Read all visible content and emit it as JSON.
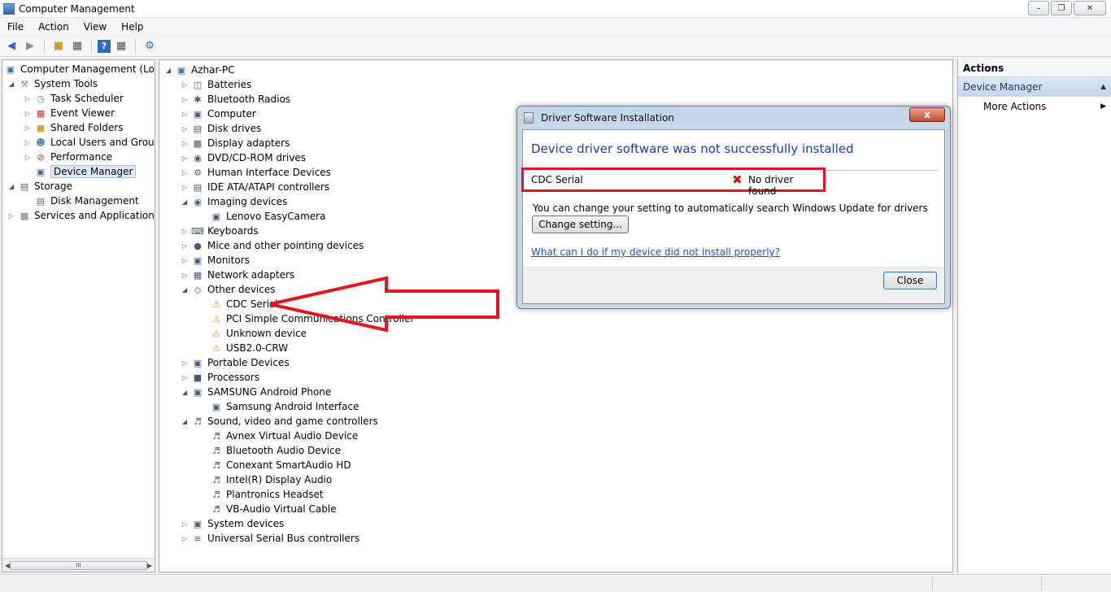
{
  "window": {
    "title": "Computer Management"
  },
  "menu": [
    "File",
    "Action",
    "View",
    "Help"
  ],
  "toolbar": {
    "icons": [
      "back-arrow-icon",
      "forward-arrow-icon",
      "up-folder-icon",
      "show-hide-tree-icon",
      "help-icon",
      "properties-icon",
      "scan-hardware-icon"
    ]
  },
  "tree": {
    "root": "Computer Management (Local",
    "system_tools": "System Tools",
    "task_scheduler": "Task Scheduler",
    "event_viewer": "Event Viewer",
    "shared_folders": "Shared Folders",
    "local_users": "Local Users and Groups",
    "performance": "Performance",
    "device_manager": "Device Manager",
    "storage": "Storage",
    "disk_management": "Disk Management",
    "services": "Services and Applications",
    "scroll_grip": "III"
  },
  "devices": {
    "computer_name": "Azhar-PC",
    "categories": [
      {
        "label": "Batteries",
        "expanded": false
      },
      {
        "label": "Bluetooth Radios",
        "expanded": false
      },
      {
        "label": "Computer",
        "expanded": false
      },
      {
        "label": "Disk drives",
        "expanded": false
      },
      {
        "label": "Display adapters",
        "expanded": false
      },
      {
        "label": "DVD/CD-ROM drives",
        "expanded": false
      },
      {
        "label": "Human Interface Devices",
        "expanded": false
      },
      {
        "label": "IDE ATA/ATAPI controllers",
        "expanded": false
      },
      {
        "label": "Imaging devices",
        "expanded": true
      },
      {
        "label": "Lenovo EasyCamera",
        "child": true
      },
      {
        "label": "Keyboards",
        "expanded": false
      },
      {
        "label": "Mice and other pointing devices",
        "expanded": false
      },
      {
        "label": "Monitors",
        "expanded": false
      },
      {
        "label": "Network adapters",
        "expanded": false
      },
      {
        "label": "Other devices",
        "expanded": true
      },
      {
        "label": "CDC Serial",
        "child": true,
        "warning": true
      },
      {
        "label": "PCI Simple Communications Controller",
        "child": true,
        "warning": true
      },
      {
        "label": "Unknown device",
        "child": true,
        "warning": true
      },
      {
        "label": "USB2.0-CRW",
        "child": true,
        "warning": true
      },
      {
        "label": "Portable Devices",
        "expanded": false
      },
      {
        "label": "Processors",
        "expanded": false
      },
      {
        "label": "SAMSUNG Android Phone",
        "expanded": true
      },
      {
        "label": "Samsung Android Interface",
        "child": true
      },
      {
        "label": "Sound, video and game controllers",
        "expanded": true
      },
      {
        "label": "Avnex Virtual Audio Device",
        "child": true
      },
      {
        "label": "Bluetooth Audio Device",
        "child": true
      },
      {
        "label": "Conexant SmartAudio HD",
        "child": true
      },
      {
        "label": "Intel(R) Display Audio",
        "child": true
      },
      {
        "label": "Plantronics Headset",
        "child": true
      },
      {
        "label": "VB-Audio Virtual Cable",
        "child": true
      },
      {
        "label": "System devices",
        "expanded": false
      },
      {
        "label": "Universal Serial Bus controllers",
        "expanded": false
      }
    ]
  },
  "actions": {
    "heading": "Actions",
    "section": "Device Manager",
    "more": "More Actions"
  },
  "dialog": {
    "title": "Driver Software Installation",
    "close_glyph": "x",
    "heading": "Device driver software was not successfully installed",
    "device": "CDC Serial",
    "status": "No driver found",
    "info": "You can change your setting to automatically search Windows Update for drivers",
    "change_button": "Change setting...",
    "help_link": "What can I do if my device did not install properly?",
    "close_button": "Close"
  },
  "colors": {
    "highlight_red": "#e3151f",
    "link_blue": "#1f52c8",
    "heading_blue": "#1b3ea0"
  }
}
